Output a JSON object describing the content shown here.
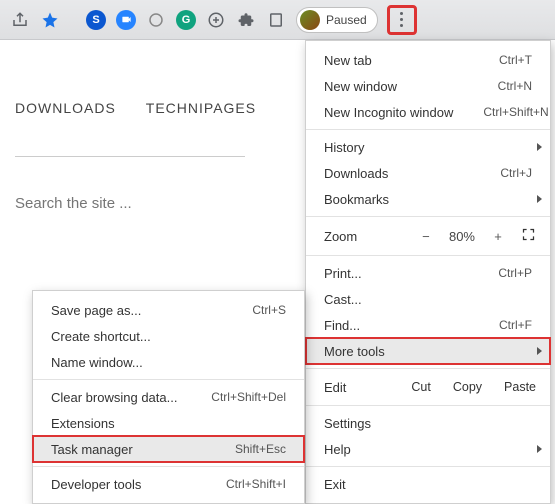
{
  "toolbar": {
    "paused_label": "Paused"
  },
  "page": {
    "nav1": "DOWNLOADS",
    "nav2": "TECHNIPAGES",
    "search_placeholder": "Search the site ..."
  },
  "menu": {
    "new_tab": "New tab",
    "new_tab_sc": "Ctrl+T",
    "new_window": "New window",
    "new_window_sc": "Ctrl+N",
    "new_incognito": "New Incognito window",
    "new_incognito_sc": "Ctrl+Shift+N",
    "history": "History",
    "downloads": "Downloads",
    "downloads_sc": "Ctrl+J",
    "bookmarks": "Bookmarks",
    "zoom_label": "Zoom",
    "zoom_value": "80%",
    "print": "Print...",
    "print_sc": "Ctrl+P",
    "cast": "Cast...",
    "find": "Find...",
    "find_sc": "Ctrl+F",
    "more_tools": "More tools",
    "edit_label": "Edit",
    "cut": "Cut",
    "copy": "Copy",
    "paste": "Paste",
    "settings": "Settings",
    "help": "Help",
    "exit": "Exit"
  },
  "submenu": {
    "save_as": "Save page as...",
    "save_as_sc": "Ctrl+S",
    "create_shortcut": "Create shortcut...",
    "name_window": "Name window...",
    "clear_data": "Clear browsing data...",
    "clear_data_sc": "Ctrl+Shift+Del",
    "extensions": "Extensions",
    "task_manager": "Task manager",
    "task_manager_sc": "Shift+Esc",
    "dev_tools": "Developer tools",
    "dev_tools_sc": "Ctrl+Shift+I"
  }
}
